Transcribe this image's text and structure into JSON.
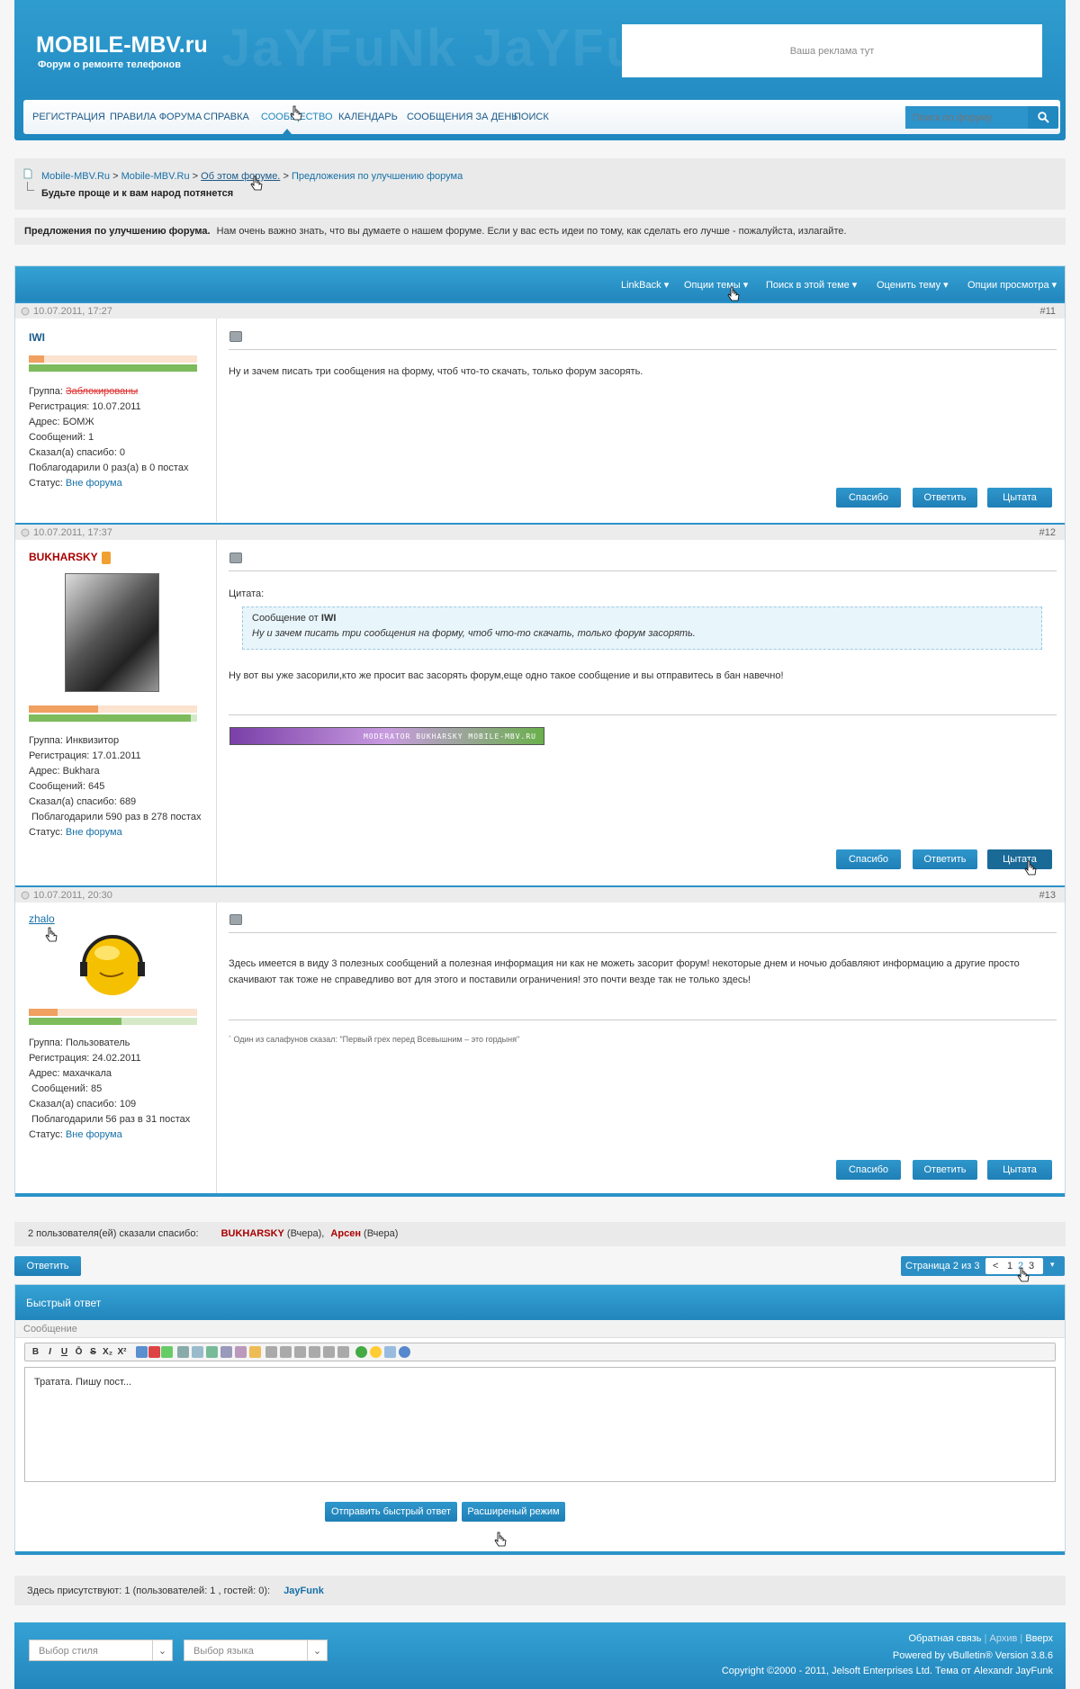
{
  "header": {
    "site_title": "MOBILE-MBV.ru",
    "site_subtitle": "Форум о ремонте телефонов",
    "watermark": "JaYFuNk JaYFuNk",
    "ad_text": "Ваша реклама тут"
  },
  "nav": {
    "items": [
      "РЕГИСТРАЦИЯ",
      "ПРАВИЛА ФОРУМА",
      "СПРАВКА",
      "СООБЩЕСТВО",
      "КАЛЕНДАРЬ",
      "СООБЩЕНИЯ ЗА ДЕНЬ",
      "ПОИСК"
    ],
    "search_placeholder": "Поиск по форуму"
  },
  "breadcrumb": {
    "items": [
      "Mobile-MBV.Ru",
      "Mobile-MBV.Ru",
      "Об этом форуме.",
      "Предложения по улучшению форума"
    ],
    "separator": ">",
    "thread_title": "Будьте проще и к вам народ потянется"
  },
  "forum_desc": {
    "title": "Предложения по улучшению форума.",
    "text": "Нам очень важно знать, что вы думаете о нашем форуме. Если у вас есть идеи по тому, как сделать его лучше - пожалуйста, излагайте."
  },
  "thread_tools": [
    "LinkBack ▾",
    "Опции темы ▾",
    "Поиск в этой теме ▾",
    "Оценить тему ▾",
    "Опции просмотра ▾"
  ],
  "posts": [
    {
      "date": "10.07.2011, 17:27",
      "number": "#11",
      "username": "IWI",
      "group_label": "Группа:",
      "group": "Заблокированы",
      "registered": "Регистрация: 10.07.2011",
      "address": "Адрес: БОМЖ",
      "messages": "Сообщений: 1",
      "said_thanks": "Сказал(а) спасибо: 0",
      "thanked": "Поблагодарили 0 раз(а) в 0 постах",
      "status_label": "Статус:",
      "status": "Вне форума",
      "rep_fill": 0.09,
      "rep2_fill": 1.0,
      "body": "Ну и зачем писать три сообщения на форму, чтоб что-то скачать, только форум засорять."
    },
    {
      "date": "10.07.2011, 17:37",
      "number": "#12",
      "username": "BUKHARSKY",
      "group_label": "Группа:",
      "group": "Инквизитор",
      "registered": "Регистрация: 17.01.2011",
      "address": "Адрес: Bukhara",
      "messages": "Сообщений: 645",
      "said_thanks": "Сказал(а) спасибо: 689",
      "thanked": "Поблагодарили 590 раз в 278 постах",
      "status_label": "Статус:",
      "status": "Вне форума",
      "rep_fill": 0.41,
      "rep2_fill": 0.96,
      "quote_label": "Цитата:",
      "quote_from": "Сообщение от",
      "quote_author": "IWI",
      "quote_text": "Ну и зачем писать три сообщения на форму, чтоб что-то скачать, только форум засорять.",
      "body": "Ну вот вы уже засорили,кто же просит вас засорять форум,еще одно такое сообщение и вы отправитесь в бан навечно!",
      "signature": "MODERATOR BUKHARSKY MOBILE-MBV.RU"
    },
    {
      "date": "10.07.2011, 20:30",
      "number": "#13",
      "username": "zhalo",
      "group_label": "Группа:",
      "group": "Пользователь",
      "registered": "Регистрация: 24.02.2011",
      "address": "Адрес: махачкала",
      "messages": "Сообщений: 85",
      "said_thanks": "Сказал(а) спасибо: 109",
      "thanked": "Поблагодарили 56 раз в 31 постах",
      "status_label": "Статус:",
      "status": "Вне форума",
      "rep_fill": 0.17,
      "rep2_fill": 0.55,
      "body_line1": "Здесь имеется в виду 3 полезных сообщений а полезная информация ни как не можеть засорит форум! некоторые днем и ночью добавляют информацию а другие просто",
      "body_line2": "скачивают так тоже не справедливо вот для этого и поставили ограничения! это почти везде так не только здесь!",
      "signature": "` Один из салафунов сказал: \"Первый грех перед Всевышним – это гордыня\""
    }
  ],
  "post_buttons": {
    "thanks": "Спасибо",
    "reply": "Ответить",
    "quote": "Цытата"
  },
  "thanks_bar": {
    "text": "2 пользователя(ей) сказали спасибо:",
    "users": [
      {
        "name": "BUKHARSKY",
        "when": "(Вчера)",
        "sep": ","
      },
      {
        "name": "Арсен",
        "when": "(Вчера)",
        "sep": ""
      }
    ]
  },
  "reply_button": "Ответить",
  "pager": {
    "label": "Страница 2 из 3",
    "prev": "<",
    "pages": [
      "1",
      "2",
      "3"
    ],
    "current": "2"
  },
  "quick_reply": {
    "title": "Быстрый ответ",
    "message_label": "Сообщение",
    "editor_text": "Тратата. Пишу пост...",
    "submit": "Отправить быстрый ответ",
    "advanced": "Расширеный режим",
    "toolbar": [
      "B",
      "I",
      "U",
      "Ō",
      "S",
      "X₂",
      "X²"
    ]
  },
  "online": {
    "text": "Здесь присутствуют: 1 (пользователей: 1 , гостей: 0):",
    "user": "JayFunk"
  },
  "footer": {
    "style_select": "Выбор стиля",
    "lang_select": "Выбор языка",
    "links": [
      "Обратная связь",
      "Архив",
      "Вверх"
    ],
    "powered": "Powered by vBulletin® Version 3.8.6",
    "copyright": "Copyright ©2000 - 2011, Jelsoft Enterprises Ltd. Тема от Alexandr JayFunk"
  },
  "colors": {
    "accent": "#2b93c9",
    "banned": "#e03030",
    "moderator": "#aa0000"
  }
}
